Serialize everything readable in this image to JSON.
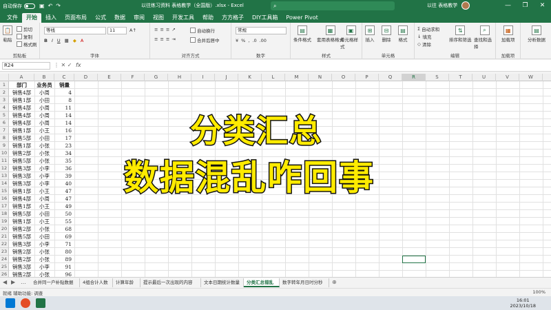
{
  "titlebar": {
    "autosave": "自动保存",
    "doc_title": "以往练习资料 表格教学（全国版）.xlsx - Excel",
    "search_placeholder": "",
    "user": "以往 表格教学",
    "controls": [
      "—",
      "❐",
      "✕"
    ]
  },
  "ribbon_tabs": [
    "文件",
    "开始",
    "插入",
    "页面布局",
    "公式",
    "数据",
    "审阅",
    "视图",
    "开发工具",
    "帮助",
    "方方格子",
    "DIY工具箱",
    "Power Pivot"
  ],
  "active_tab": "开始",
  "ribbon": {
    "clipboard": {
      "label": "剪贴板",
      "paste": "粘贴",
      "cut": "剪切",
      "copy": "复制",
      "painter": "格式刷"
    },
    "font": {
      "label": "字体",
      "name": "等线",
      "size": "11"
    },
    "alignment": {
      "label": "对齐方式",
      "wrap": "自动换行",
      "merge": "合并后居中"
    },
    "number": {
      "label": "数字",
      "format": "常规"
    },
    "styles": {
      "label": "样式",
      "conditional": "条件格式",
      "table": "套用表格格式",
      "cell": "单元格样式"
    },
    "cells": {
      "label": "单元格",
      "insert": "插入",
      "delete": "删除",
      "format": "格式"
    },
    "editing": {
      "label": "编辑",
      "autosum": "自动求和",
      "fill": "填充",
      "clear": "清除",
      "sort": "排序和筛选",
      "find": "查找和选择"
    },
    "addins": {
      "label": "加载项",
      "addin": "加载项"
    },
    "analysis": {
      "label": "",
      "analyze": "分析数据"
    }
  },
  "namebox": "R24",
  "columns": [
    "A",
    "B",
    "C",
    "D",
    "E",
    "F",
    "G",
    "H",
    "I",
    "J",
    "K",
    "L",
    "M",
    "N",
    "O",
    "P",
    "Q",
    "R",
    "S",
    "T",
    "U",
    "V",
    "W"
  ],
  "selected_column": "R",
  "table": {
    "headers": [
      "部门",
      "业务员",
      "销量"
    ],
    "rows": [
      [
        "销售4部",
        "小周",
        "4"
      ],
      [
        "销售1部",
        "小田",
        "8"
      ],
      [
        "销售4部",
        "小周",
        "11"
      ],
      [
        "销售4部",
        "小周",
        "14"
      ],
      [
        "销售4部",
        "小周",
        "14"
      ],
      [
        "销售1部",
        "小王",
        "16"
      ],
      [
        "销售5部",
        "小田",
        "17"
      ],
      [
        "销售1部",
        "小张",
        "23"
      ],
      [
        "销售2部",
        "小张",
        "34"
      ],
      [
        "销售5部",
        "小张",
        "35"
      ],
      [
        "销售3部",
        "小李",
        "36"
      ],
      [
        "销售3部",
        "小李",
        "39"
      ],
      [
        "销售3部",
        "小李",
        "40"
      ],
      [
        "销售1部",
        "小王",
        "47"
      ],
      [
        "销售4部",
        "小周",
        "47"
      ],
      [
        "销售1部",
        "小王",
        "49"
      ],
      [
        "销售5部",
        "小田",
        "50"
      ],
      [
        "销售1部",
        "小王",
        "55"
      ],
      [
        "销售2部",
        "小张",
        "68"
      ],
      [
        "销售5部",
        "小田",
        "69"
      ],
      [
        "销售3部",
        "小李",
        "71"
      ],
      [
        "销售2部",
        "小张",
        "80"
      ],
      [
        "销售2部",
        "小张",
        "89"
      ],
      [
        "销售3部",
        "小李",
        "91"
      ],
      [
        "销售2部",
        "小张",
        "96"
      ]
    ]
  },
  "row_count": 26,
  "overlay": {
    "line1": "分类汇总",
    "line2": "数据混乱咋回事"
  },
  "sheet_tabs": [
    "合并同一户补贴数据",
    "4组合计人数",
    "计算年龄",
    "提示最后一次出现的内容",
    "文本日期统计数量",
    "分类汇总错乱",
    "数字转年月日时分秒"
  ],
  "active_sheet": "分类汇总错乱",
  "status": {
    "left": "就绪  辅助功能: 调查",
    "zoom": "100%"
  },
  "taskbar": {
    "time": "16:01",
    "date": "2023/10/18"
  }
}
